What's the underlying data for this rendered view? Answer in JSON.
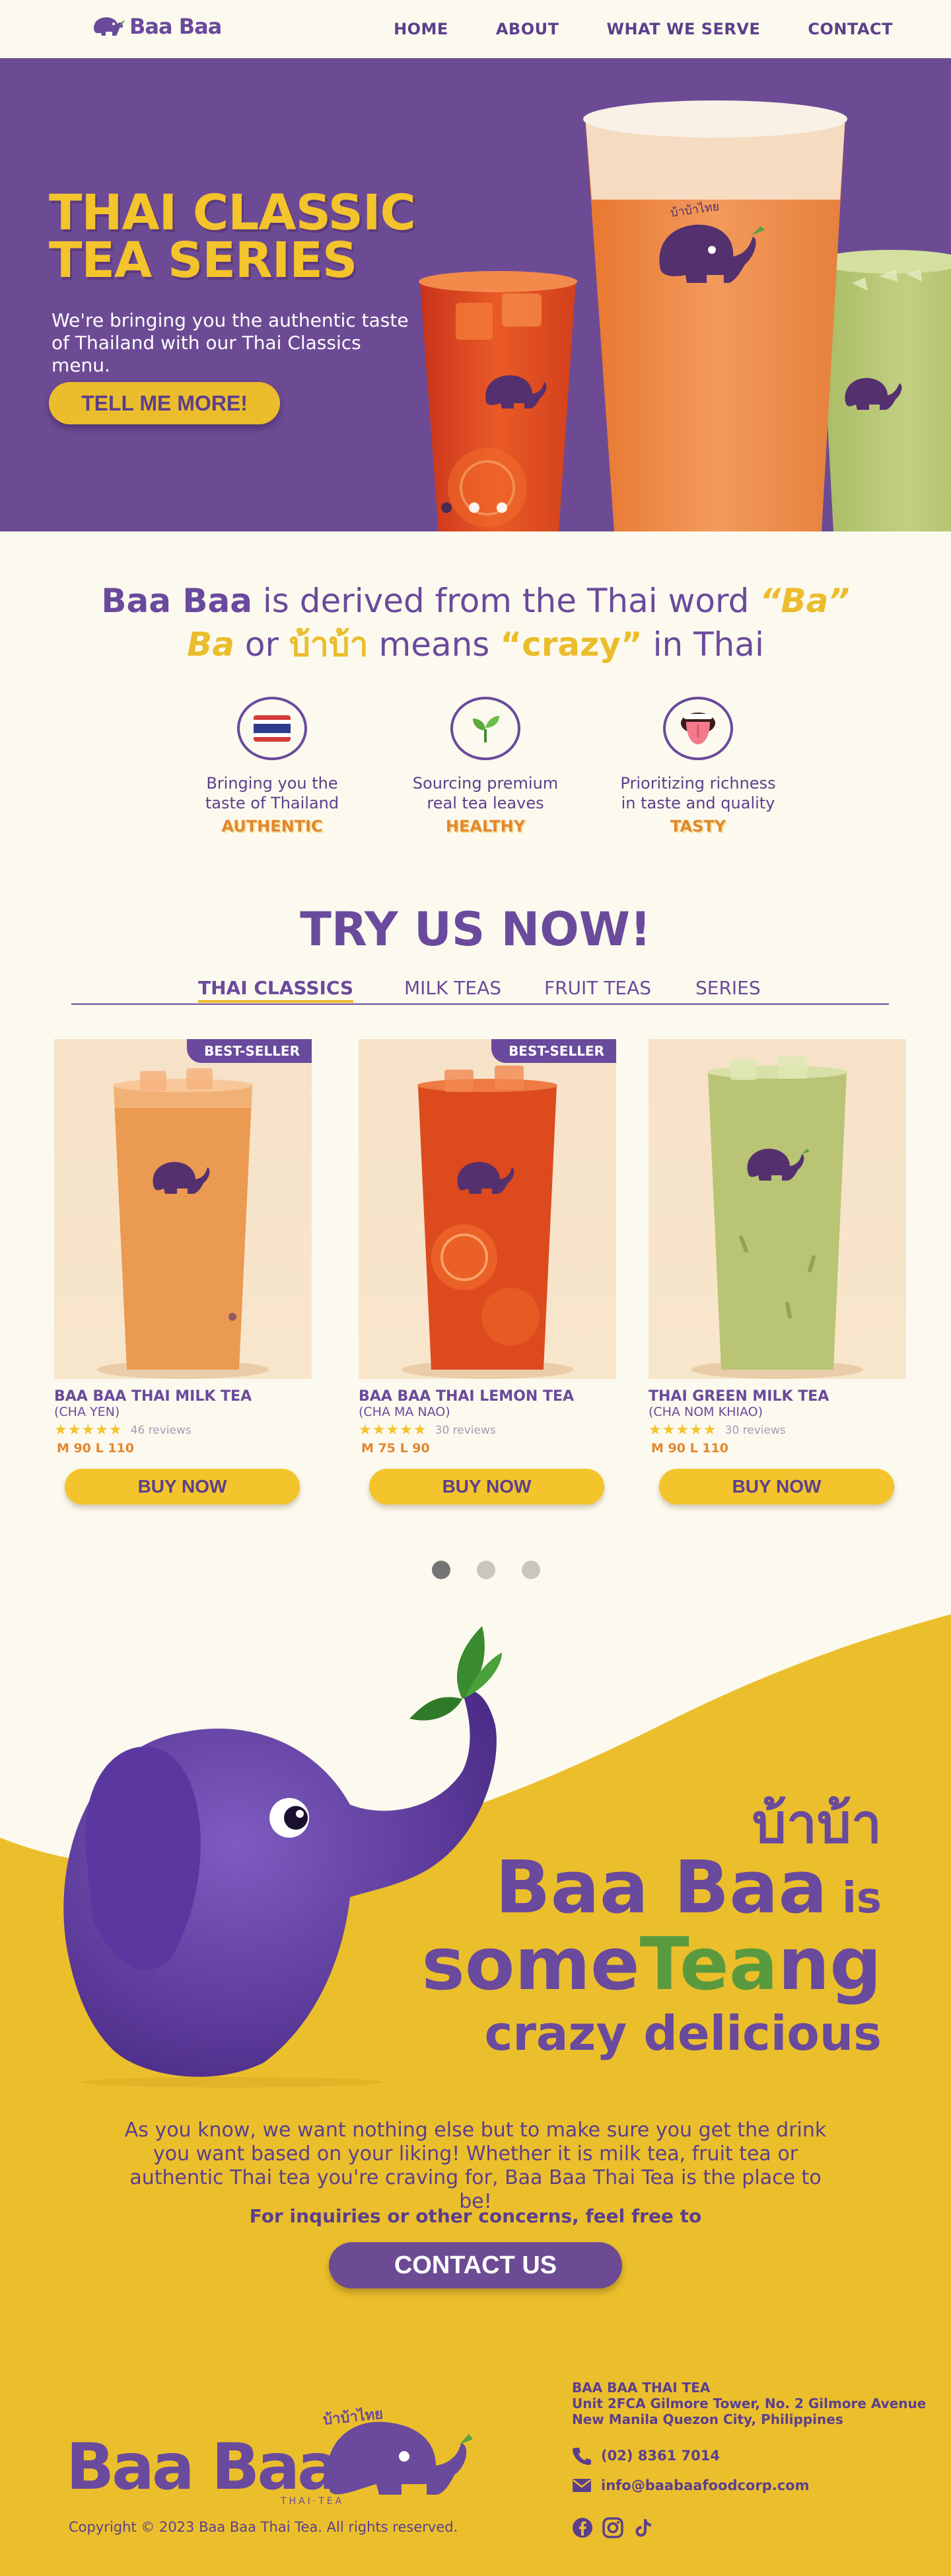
{
  "nav": {
    "brand": "Baa Baa",
    "links": [
      "HOME",
      "ABOUT",
      "WHAT WE SERVE",
      "CONTACT"
    ]
  },
  "hero": {
    "title_line1": "THAI CLASSIC",
    "title_line2": "TEA SERIES",
    "description": "We're bringing you the authentic taste of Thailand with our Thai Classics menu.",
    "cta": "TELL ME MORE!",
    "cup_print": "บ้าบ้าไทย",
    "slides": 3,
    "active_slide": 1
  },
  "about": {
    "l1_brand": "Baa Baa",
    "l1_mid": " is derived from the Thai word ",
    "l1_word": "“Ba”",
    "l2_word": "Ba",
    "l2_or": " or ",
    "l2_thai": "บ้าบ้า",
    "l2_means": " means ",
    "l2_crazy": "“crazy”",
    "l2_end": " in Thai"
  },
  "features": [
    {
      "icon": "thai-flag-icon",
      "line1": "Bringing you the",
      "line2": "taste of Thailand",
      "tag": "AUTHENTIC"
    },
    {
      "icon": "sprout-icon",
      "line1": "Sourcing premium",
      "line2": "real tea leaves",
      "tag": "HEALTHY"
    },
    {
      "icon": "tongue-icon",
      "line1": "Prioritizing richness",
      "line2": "in taste and quality",
      "tag": "TASTY"
    }
  ],
  "menu": {
    "title": "TRY US NOW!",
    "tabs": [
      "THAI CLASSICS",
      "MILK TEAS",
      "FRUIT TEAS",
      "SERIES"
    ],
    "active_tab": 0,
    "buy_label": "BUY NOW",
    "products": [
      {
        "name": "BAA BAA THAI MILK TEA",
        "thai": "(CHA YEN)",
        "rating": 5,
        "reviews": "46 reviews",
        "sizes": "M 90 L 110",
        "badge": "BEST-SELLER",
        "color": "#eb9a52"
      },
      {
        "name": "BAA BAA THAI LEMON TEA",
        "thai": "(CHA MA NAO)",
        "rating": 5,
        "reviews": "30 reviews",
        "sizes": "M 75 L 90",
        "badge": "BEST-SELLER",
        "color": "#dc4a1e"
      },
      {
        "name": "THAI GREEN MILK TEA",
        "thai": "(CHA NOM KHIAO)",
        "rating": 5,
        "reviews": "30 reviews",
        "sizes": "M 90 L 110",
        "badge": "",
        "color": "#b9c474"
      }
    ],
    "pages": 3,
    "active_page": 0
  },
  "promo": {
    "thai": "บ้าบ้า",
    "brand": "Baa Baa",
    "is": " is",
    "some": "some",
    "tea": "Tea",
    "ng": "ng",
    "crazy": "crazy delicious",
    "body": "As you know, we want nothing else but to make sure you get the drink you want based on your liking! Whether it is milk tea, fruit tea or authentic Thai tea you're craving for, Baa Baa Thai Tea is the place to be!",
    "inquiry": "For inquiries or other concerns, feel free to",
    "cta": "CONTACT US"
  },
  "footer": {
    "logo_text": "Baa Baa",
    "logo_sub": "THAI·TEA",
    "logo_thai": "บ้าบ้าไทย",
    "copyright": "Copyright © 2023 Baa Baa Thai Tea. All rights reserved.",
    "company": "BAA BAA THAI TEA",
    "address1": "Unit 2FCA Gilmore Tower, No. 2 Gilmore Avenue",
    "address2": "New Manila Quezon City, Philippines",
    "phone": "(02) 8361 7014",
    "email": "info@baabaafoodcorp.com",
    "socials": [
      "facebook-icon",
      "instagram-icon",
      "tiktok-icon"
    ]
  },
  "colors": {
    "purple": "#6d4b94",
    "yellow": "#ebbd2c",
    "cream": "#fcf9ee",
    "orange": "#e3872e",
    "green": "#5a9a3e"
  }
}
